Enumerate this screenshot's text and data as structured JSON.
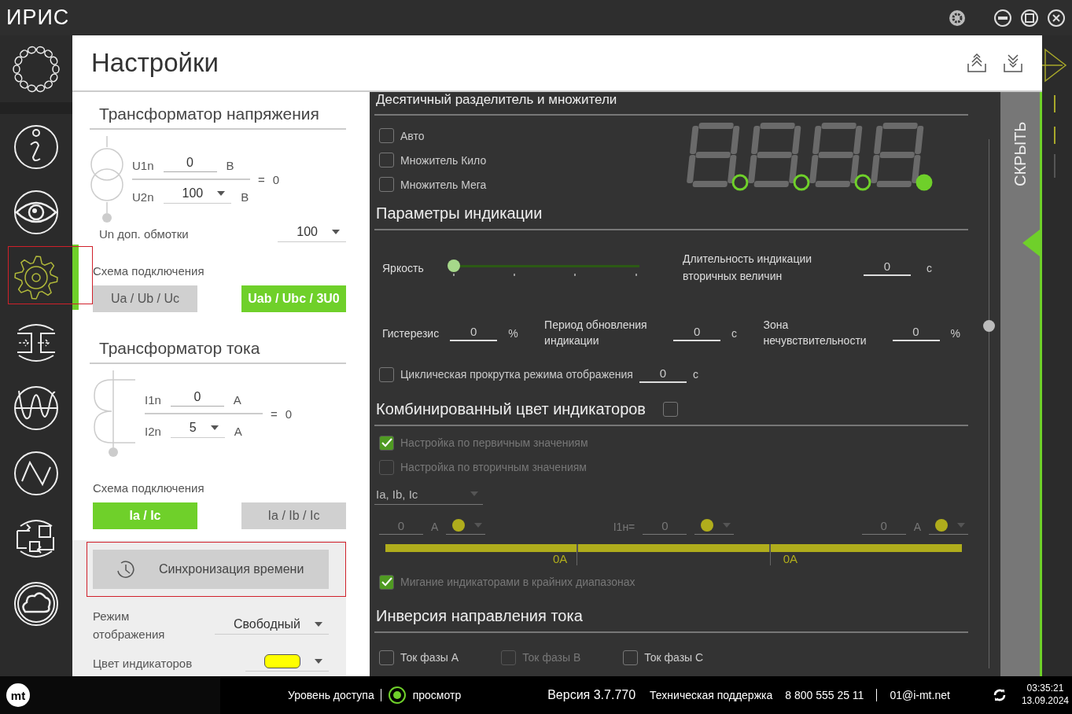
{
  "title_bar": {
    "app_name": "ИРИС"
  },
  "sidebar": {
    "items": [
      {
        "kind": "info",
        "selected": false,
        "highlighted": false
      },
      {
        "kind": "eye",
        "selected": false,
        "highlighted": false
      },
      {
        "kind": "gear",
        "selected": true,
        "highlighted": true
      },
      {
        "kind": "transfer",
        "selected": false,
        "highlighted": false
      },
      {
        "kind": "sine",
        "selected": false,
        "highlighted": false
      },
      {
        "kind": "triangle",
        "selected": false,
        "highlighted": false
      },
      {
        "kind": "exchange",
        "selected": false,
        "highlighted": false
      },
      {
        "kind": "cloud",
        "selected": false,
        "highlighted": false
      }
    ]
  },
  "header": {
    "title": "Настройки"
  },
  "left_panel": {
    "voltage": {
      "heading": "Трансформатор напряжения",
      "primary": {
        "label": "U1n",
        "value": "0",
        "unit": "В"
      },
      "secondary": {
        "label": "U2n",
        "value": "100",
        "unit": "В"
      },
      "equals": "=",
      "ratio": "0",
      "extra": {
        "label": "Un доп. обмотки",
        "value": "100"
      },
      "scheme_label": "Схема подключения",
      "schemes": [
        {
          "label": "Ua / Ub / Uc",
          "selected": false
        },
        {
          "label": "Uab / Ubc / 3U0",
          "selected": true
        }
      ]
    },
    "current": {
      "heading": "Трансформатор тока",
      "primary": {
        "label": "I1n",
        "value": "0",
        "unit": "А"
      },
      "secondary": {
        "label": "I2n",
        "value": "5",
        "unit": "А"
      },
      "equals": "=",
      "ratio": "0",
      "scheme_label": "Схема подключения",
      "schemes": [
        {
          "label": "Ia / Ic",
          "selected": true
        },
        {
          "label": "Ia / Ib / Ic",
          "selected": false
        }
      ]
    },
    "sync_button": {
      "label": "Синхронизация времени",
      "highlighted": true
    },
    "display_mode": {
      "label": "Режим отображения",
      "value": "Свободный"
    },
    "indicator_color": {
      "label": "Цвет индикаторов",
      "color": "#ffff00"
    }
  },
  "dark_panel": {
    "decimal": {
      "heading": "Десятичный разделитель и множители",
      "options": [
        {
          "label": "Авто",
          "checked": false
        },
        {
          "label": "Множитель Кило",
          "checked": false
        },
        {
          "label": "Множитель Мега",
          "checked": false
        }
      ],
      "points": [
        {
          "selected": false
        },
        {
          "selected": false
        },
        {
          "selected": false
        },
        {
          "selected": true
        }
      ]
    },
    "indication": {
      "heading": "Параметры индикации",
      "brightness": {
        "label": "Яркость",
        "level": 0
      },
      "duration": {
        "label": "Длительность индикации вторичных величин",
        "value": "0",
        "unit": "с"
      },
      "fields": [
        {
          "label": "Гистерезис",
          "value": "0",
          "unit": "%"
        },
        {
          "label": "Период обновления индикации",
          "value": "0",
          "unit": "с"
        },
        {
          "label": "Зона нечувствительности",
          "value": "0",
          "unit": "%"
        }
      ],
      "cycle": {
        "label": "Циклическая прокрутка режима отображения",
        "checked": false,
        "value": "0",
        "unit": "с"
      }
    },
    "combined": {
      "heading": "Комбинированный цвет индикаторов",
      "checked": false,
      "options": [
        {
          "label": "Настройка по первичным значениям",
          "checked": true
        },
        {
          "label": "Настройка по вторичным значениям",
          "checked": false
        }
      ],
      "phase_select": "Ia, Ib, Ic",
      "thresholds": [
        {
          "value": "0",
          "unit": "А",
          "color": "#b0ad1c"
        },
        {
          "prefix": "I1н=",
          "value": "0",
          "color": "#b0ad1c"
        },
        {
          "value": "0",
          "unit": "А",
          "color": "#b0ad1c"
        }
      ],
      "bar_labels": [
        "0A",
        "0A"
      ],
      "blink": {
        "label": "Мигание индикаторами в крайних диапазонах",
        "checked": true
      }
    },
    "inversion": {
      "heading": "Инверсия направления тока",
      "phases": [
        {
          "label": "Ток фазы А",
          "checked": false,
          "disabled": false
        },
        {
          "label": "Ток фазы В",
          "checked": false,
          "disabled": true
        },
        {
          "label": "Ток фазы С",
          "checked": false,
          "disabled": false
        }
      ]
    }
  },
  "hide_tab": {
    "label": "СКРЫТЬ"
  },
  "footer": {
    "logo_text": "mt",
    "access_label": "Уровень доступа",
    "access_value": "просмотр",
    "version": "Версия 3.7.770",
    "support_label": "Техническая поддержка",
    "phone": "8 800 555 25 11",
    "email": "01@i-mt.net",
    "time": "03:35:21",
    "date": "13.09.2024"
  }
}
